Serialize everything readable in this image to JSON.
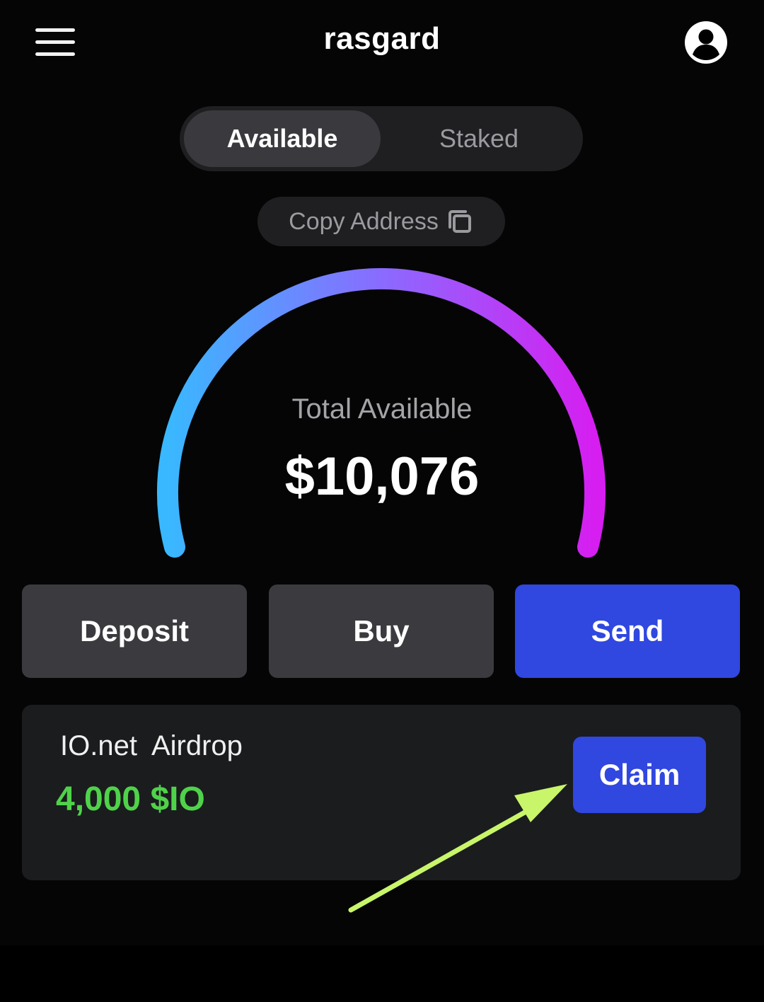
{
  "header": {
    "title": "rasgard",
    "menu_icon": "hamburger-menu-icon",
    "profile_icon": "user-avatar-icon"
  },
  "tabs": [
    {
      "label": "Available",
      "active": true
    },
    {
      "label": "Staked",
      "active": false
    }
  ],
  "copy_address": {
    "label": "Copy Address",
    "icon": "copy-icon"
  },
  "balance": {
    "label": "Total Available",
    "value": "$10,076",
    "gauge_colors": [
      "#39b8ff",
      "#8a6bff",
      "#d61ef0"
    ]
  },
  "actions": {
    "deposit_label": "Deposit",
    "buy_label": "Buy",
    "send_label": "Send"
  },
  "airdrop": {
    "title": "IO.net  Airdrop",
    "amount": "4,000 $IO",
    "claim_label": "Claim"
  },
  "colors": {
    "accent": "#3047e0",
    "positive": "#4fd24a",
    "annotation_arrow": "#c8f56a"
  }
}
